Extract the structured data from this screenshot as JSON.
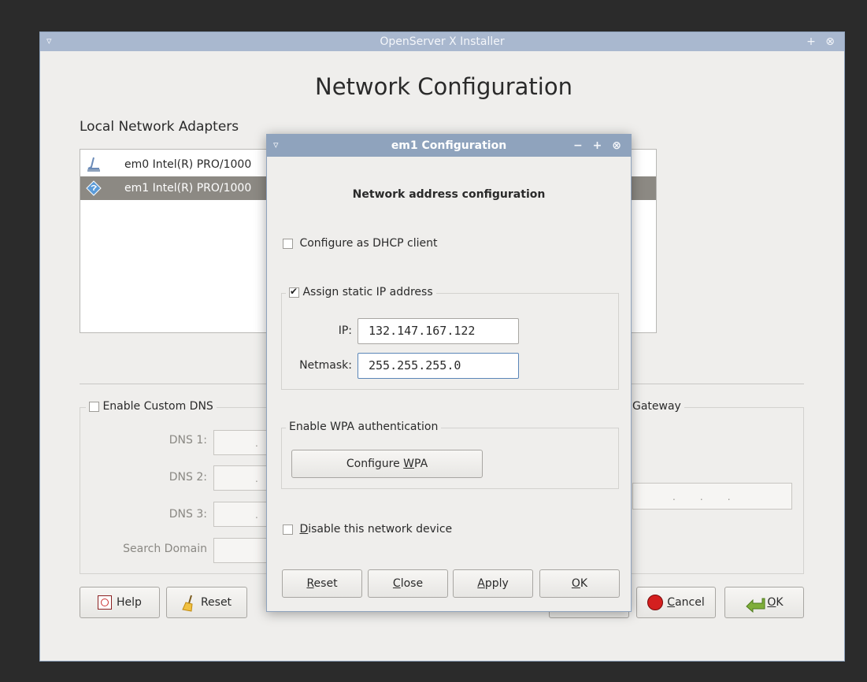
{
  "main_window": {
    "title": "OpenServer X Installer",
    "menu_glyph": "▿",
    "title_buttons": "+ ⊗",
    "heading": "Network Configuration",
    "adapters_label": "Local Network Adapters",
    "adapters": [
      {
        "label": "em0  Intel(R) PRO/1000",
        "icon": "wired-network-icon",
        "selected": false
      },
      {
        "label": "em1  Intel(R) PRO/1000",
        "icon": "network-diamond-icon",
        "selected": true
      }
    ],
    "dns": {
      "enable_label": "Enable Custom DNS",
      "dns1_label": "DNS 1:",
      "dns2_label": "DNS 2:",
      "dns3_label": "DNS 3:",
      "search_domain_label": "Search Domain",
      "field_dots": ".",
      "gateway_title_partial": "Gateway",
      "gateway_dots": ".     .     ."
    },
    "buttons": {
      "help": "Help",
      "reset": "Reset",
      "cancel_prefix": "",
      "cancel_u": "C",
      "cancel_rest": "ancel",
      "ok_u": "O",
      "ok_rest": "K"
    }
  },
  "dialog": {
    "title": "em1  Configuration",
    "menu_glyph": "▿",
    "title_buttons": "− + ⊗",
    "heading": "Network address configuration",
    "dhcp_label": "Configure as DHCP client",
    "dhcp_checked": false,
    "static_label": "Assign static IP address",
    "static_checked": true,
    "ip_label": "IP:",
    "ip_value": "132.147.167.122",
    "netmask_label": "Netmask:",
    "netmask_value": "255.255.255.0",
    "wpa_group_label": "Enable WPA authentication",
    "wpa_button_pre": "Configure ",
    "wpa_button_u": "W",
    "wpa_button_post": "PA",
    "disable_u": "D",
    "disable_rest": "isable this network device",
    "disable_checked": false,
    "buttons": {
      "reset_u": "R",
      "reset_rest": "eset",
      "close_u": "C",
      "close_rest": "lose",
      "apply_pre": "",
      "apply_u": "A",
      "apply_rest": "pply",
      "ok_u": "O",
      "ok_rest": "K"
    }
  },
  "colors": {
    "titlebar_inactive": "#a9b8cf",
    "titlebar_active": "#8fa3bd",
    "selection": "#8c8983",
    "window_bg": "#efeeec"
  }
}
